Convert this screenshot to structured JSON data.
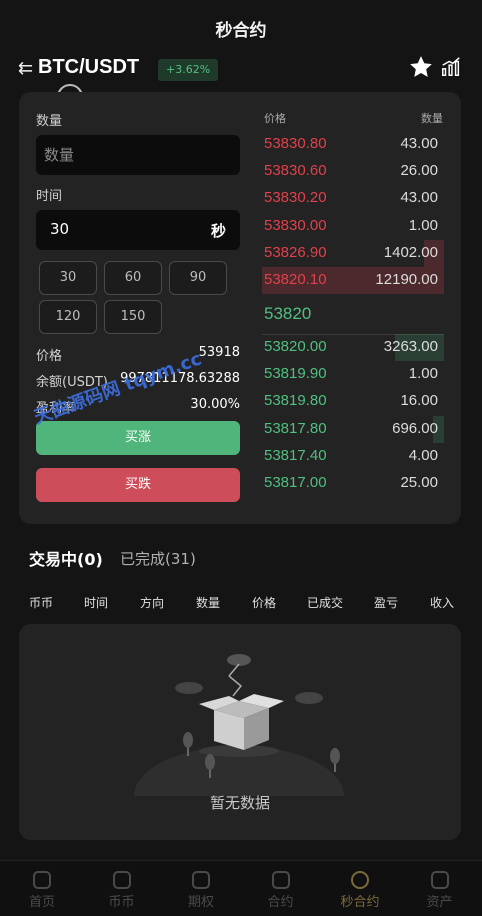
{
  "header": {
    "title": "秒合约"
  },
  "pair": {
    "name": "BTC/USDT",
    "change": "+3.62%",
    "back_icon": "back-icon",
    "star_icon": "star-icon",
    "chart_icon": "chart-icon"
  },
  "form": {
    "quantity_label": "数量",
    "quantity_placeholder": "数量",
    "time_label": "时间",
    "time_value": "30",
    "time_unit": "秒",
    "time_options": [
      "30",
      "60",
      "90",
      "120",
      "150"
    ],
    "price_label": "价格",
    "price_value": "53918",
    "balance_label": "余额(USDT)",
    "balance_value": "997811178.63288",
    "profit_label": "盈利率",
    "profit_value": "30.00%",
    "buy_up": "买涨",
    "buy_down": "买跌"
  },
  "orderbook": {
    "price_header": "价格",
    "qty_header": "数量",
    "asks": [
      {
        "price": "53830.80",
        "qty": "43.00",
        "depth": 0
      },
      {
        "price": "53830.60",
        "qty": "26.00",
        "depth": 0
      },
      {
        "price": "53830.20",
        "qty": "43.00",
        "depth": 0
      },
      {
        "price": "53830.00",
        "qty": "1.00",
        "depth": 0
      },
      {
        "price": "53826.90",
        "qty": "1402.00",
        "depth": 0.11
      },
      {
        "price": "53820.10",
        "qty": "12190.00",
        "depth": 1.0
      }
    ],
    "last_price": "53820",
    "bids": [
      {
        "price": "53820.00",
        "qty": "3263.00",
        "depth": 0.27
      },
      {
        "price": "53819.90",
        "qty": "1.00",
        "depth": 0
      },
      {
        "price": "53819.80",
        "qty": "16.00",
        "depth": 0
      },
      {
        "price": "53817.80",
        "qty": "696.00",
        "depth": 0.06
      },
      {
        "price": "53817.40",
        "qty": "4.00",
        "depth": 0
      },
      {
        "price": "53817.00",
        "qty": "25.00",
        "depth": 0
      }
    ]
  },
  "trades": {
    "tab_active": "交易中(0)",
    "tab_done": "已完成(31)",
    "columns": [
      "币币",
      "时间",
      "方向",
      "数量",
      "价格",
      "已成交",
      "盈亏",
      "收入"
    ],
    "empty_text": "暂无数据"
  },
  "nav": {
    "items": [
      {
        "label": "首页",
        "icon": "home-icon"
      },
      {
        "label": "币币",
        "icon": "coin-icon"
      },
      {
        "label": "期权",
        "icon": "options-icon"
      },
      {
        "label": "合约",
        "icon": "contract-icon"
      },
      {
        "label": "秒合约",
        "icon": "seconds-contract-icon"
      },
      {
        "label": "资产",
        "icon": "wallet-icon"
      }
    ]
  },
  "watermark": "天曲源码网 tqym.cc",
  "colors": {
    "up": "#4fb57a",
    "down": "#cd4e5a",
    "ask_text": "#e0414c",
    "bid_text": "#4fc07f"
  }
}
